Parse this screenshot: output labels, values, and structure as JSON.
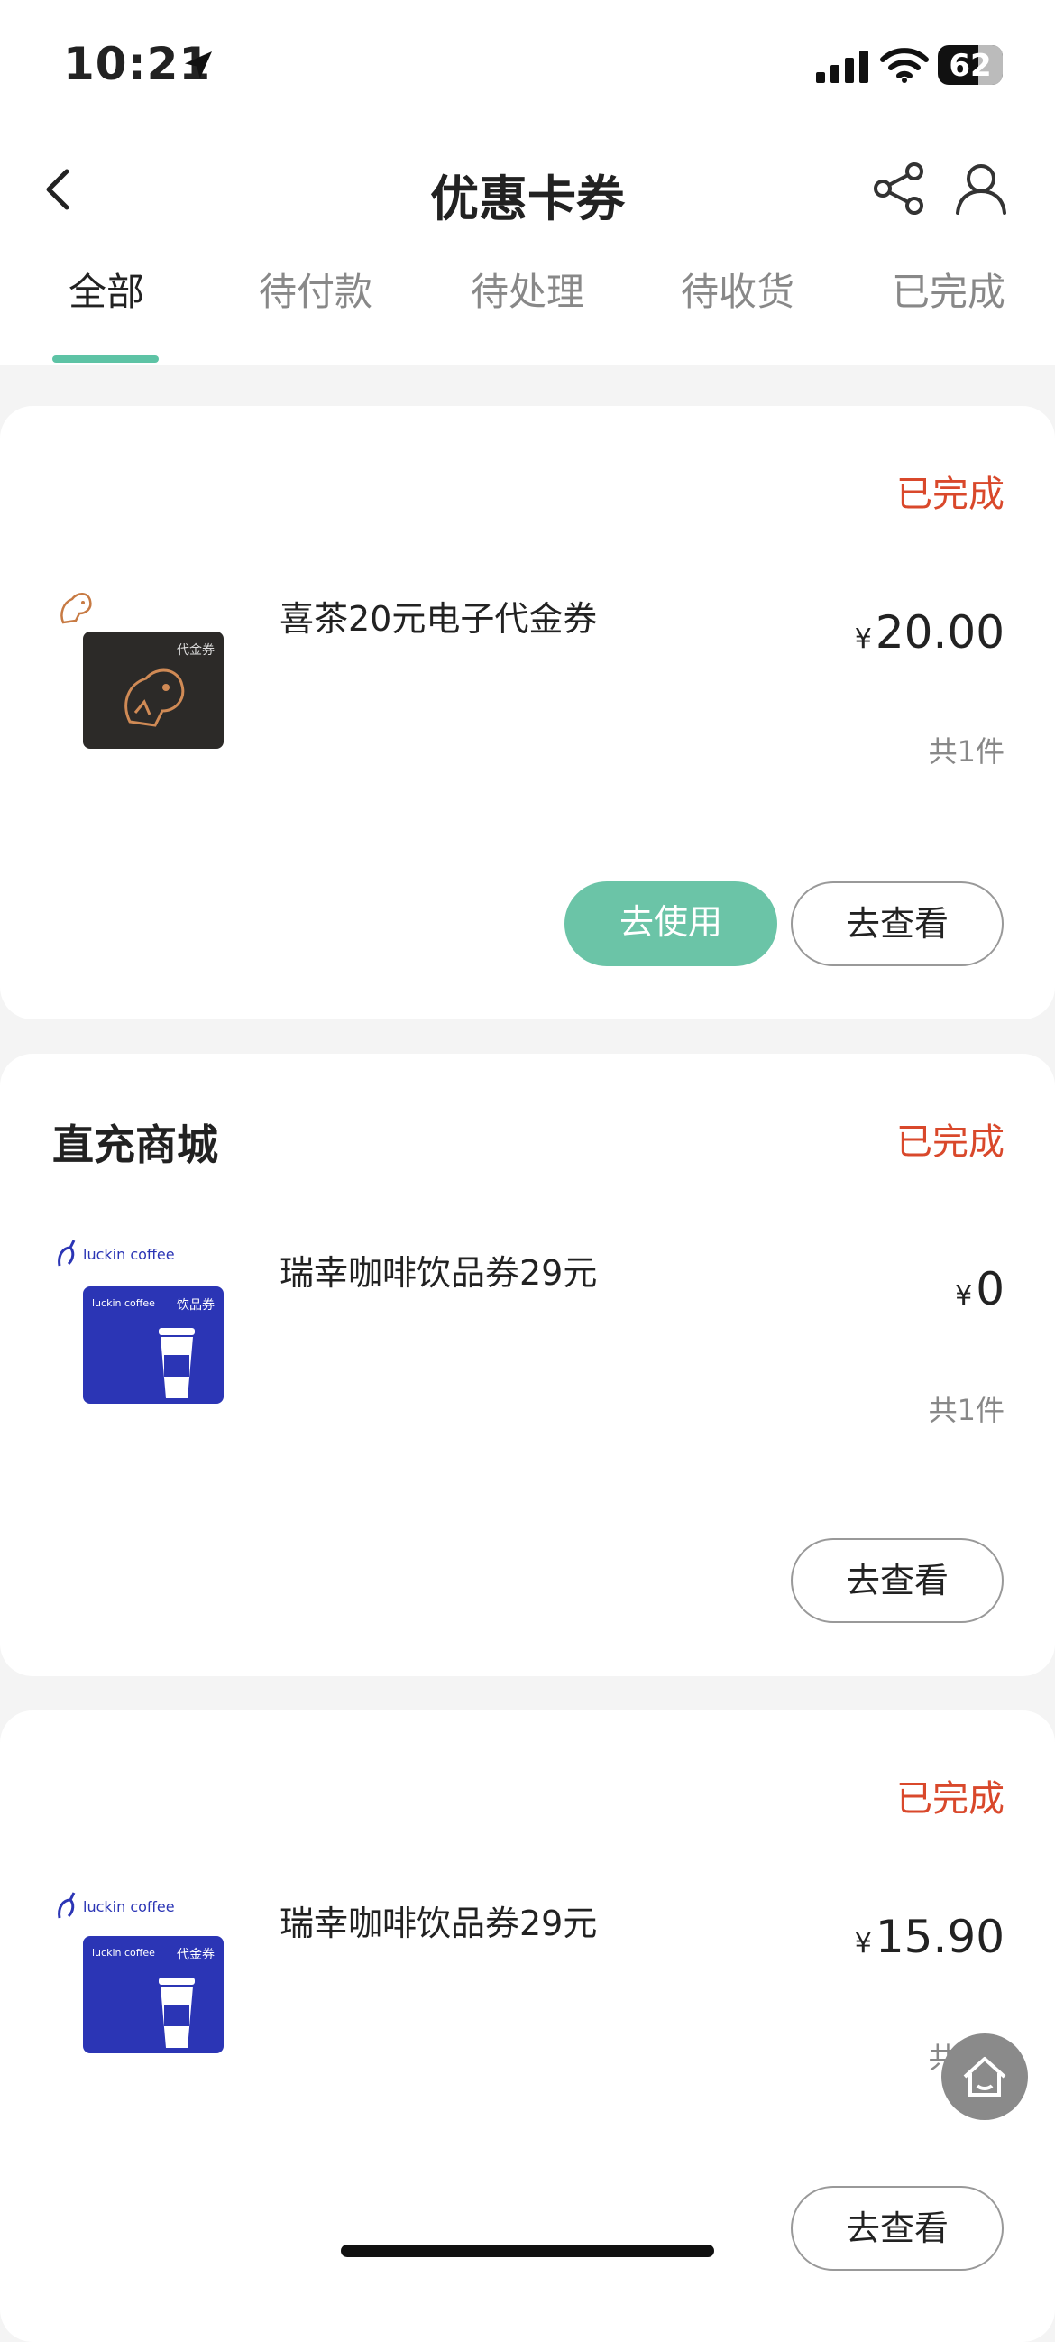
{
  "status_bar": {
    "time": "10:21",
    "battery": "62",
    "battery_level": 0.62
  },
  "header": {
    "title": "优惠卡券"
  },
  "tabs": [
    {
      "label": "全部",
      "active": true
    },
    {
      "label": "待付款"
    },
    {
      "label": "待处理"
    },
    {
      "label": "待收货"
    },
    {
      "label": "已完成"
    }
  ],
  "orders": [
    {
      "shop": "",
      "status": "已完成",
      "product_name": "喜茶20元电子代金券",
      "currency": "¥",
      "price": "20.00",
      "quantity": "共1件",
      "card_label": "代金券",
      "buttons": {
        "use": "去使用",
        "view": "去查看"
      }
    },
    {
      "shop": "直充商城",
      "status": "已完成",
      "product_name": "瑞幸咖啡饮品券29元",
      "currency": "¥",
      "price": "0",
      "quantity": "共1件",
      "brand": "luckin coffee",
      "card_label": "饮品券",
      "buttons": {
        "view": "去查看"
      }
    },
    {
      "shop": "",
      "status": "已完成",
      "product_name": "瑞幸咖啡饮品券29元",
      "currency": "¥",
      "price": "15.90",
      "quantity": "共1件",
      "brand": "luckin coffee",
      "card_label": "代金券",
      "buttons": {
        "view": "去查看"
      }
    }
  ],
  "colors": {
    "accent": "#5dc3a5",
    "status": "#d9482b",
    "luckin_blue": "#2b35b5"
  }
}
